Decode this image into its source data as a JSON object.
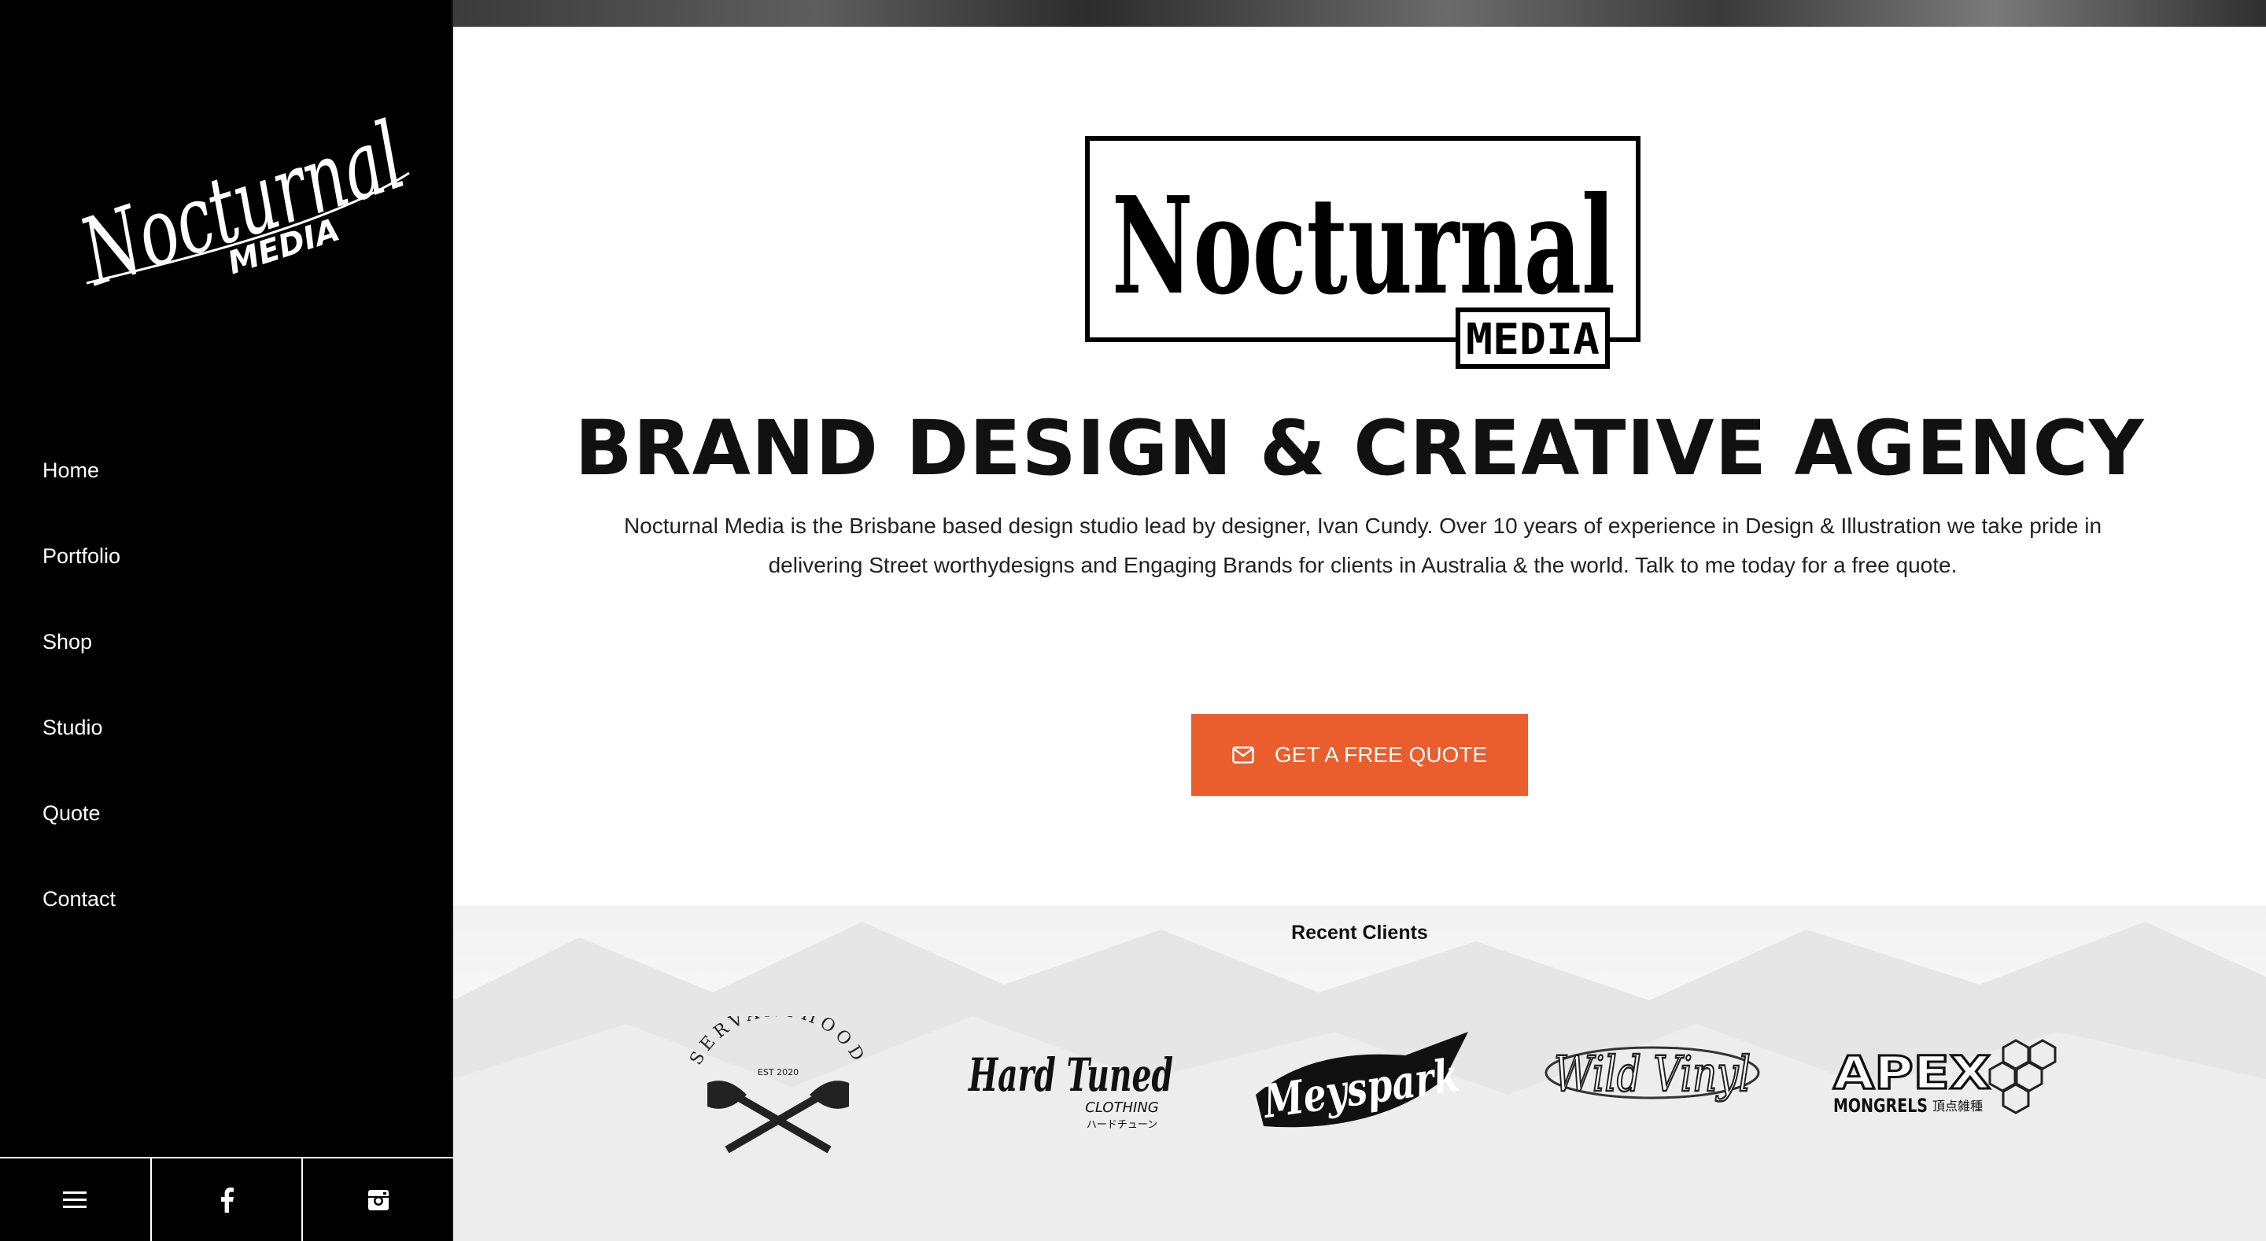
{
  "sidebar": {
    "logo_text": {
      "main": "Nocturnal",
      "sub": "MEDIA"
    },
    "nav": [
      "Home",
      "Portfolio",
      "Shop",
      "Studio",
      "Quote",
      "Contact"
    ],
    "bottom_icons": [
      "menu-icon",
      "facebook-icon",
      "instagram-icon"
    ]
  },
  "hero": {
    "logo_text": {
      "main": "Nocturnal",
      "sub": "MEDIA"
    },
    "headline": "BRAND DESIGN & CREATIVE AGENCY",
    "intro": "Nocturnal Media is the Brisbane based design studio lead by designer, Ivan Cundy.  Over 10 years of experience in Design & Illustration we take pride in delivering Street worthydesigns and Engaging Brands for clients in Australia & the world. Talk to me today for a free quote.",
    "cta_label": "GET A FREE QUOTE",
    "cta_icon": "mail-icon",
    "accent": "#ea5d2c"
  },
  "clients": {
    "title": "Recent Clients",
    "logos": [
      {
        "name": "SERVANTHOOD",
        "sub": "EST 2020"
      },
      {
        "name": "Hard Tuned",
        "sub": "CLOTHING",
        "sub2": "ハードチューン"
      },
      {
        "name": "Meyspark"
      },
      {
        "name": "Wild Vinyl"
      },
      {
        "name": "APEX",
        "sub": "MONGRELS",
        "sub2": "頂点雑種"
      }
    ]
  }
}
